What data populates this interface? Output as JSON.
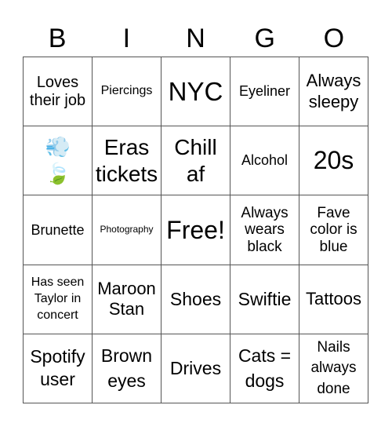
{
  "header": [
    "B",
    "I",
    "N",
    "G",
    "O"
  ],
  "cells": [
    [
      "Loves their job",
      "Piercings",
      "NYC",
      "Eyeliner",
      "Always sleepy"
    ],
    [
      "💨 🍃",
      "Eras tickets",
      "Chill af",
      "Alcohol",
      "20s"
    ],
    [
      "Brunette",
      "Photography",
      "Free!",
      "Always wears black",
      "Fave color is blue"
    ],
    [
      "Has seen Taylor in concert",
      "Maroon Stan",
      "Shoes",
      "Swiftie",
      "Tattoos"
    ],
    [
      "Spotify user",
      "Brown eyes",
      "Drives",
      "Cats = dogs",
      "Nails always done"
    ]
  ]
}
